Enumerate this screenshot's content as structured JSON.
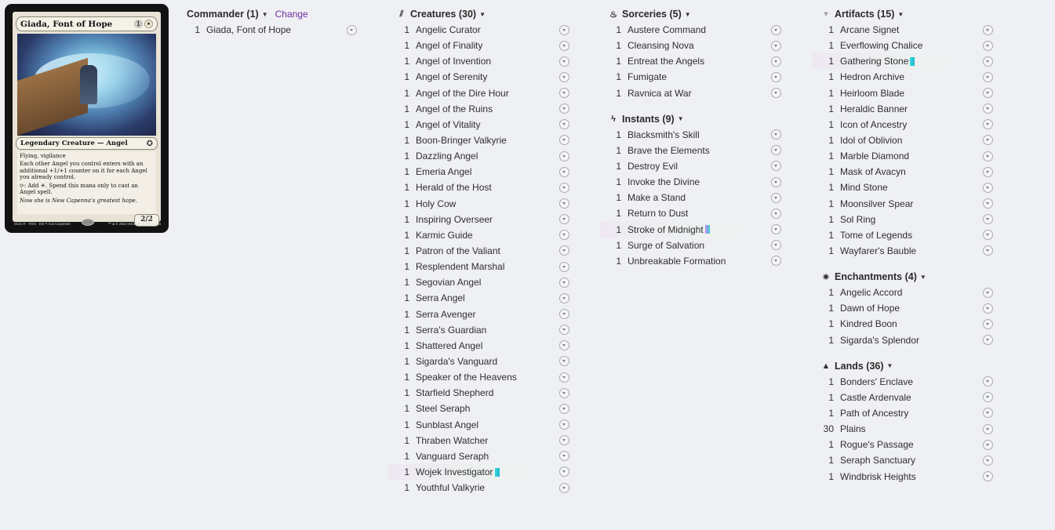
{
  "card": {
    "name": "Giada, Font of Hope",
    "cost_generic": "1",
    "cost_white": "☀",
    "type_line": "Legendary Creature — Angel",
    "rules": [
      "Flying, vigilance",
      "Each other Angel you control enters with an additional +1/+1 counter on it for each Angel you already control.",
      "⟳: Add ☀. Spend this mana only to cast an Angel spell."
    ],
    "flavor": "Now she is New Capenna's greatest hope.",
    "pt": "2/2",
    "footer_left": "0141 R · FDN · EN  ✎ Kai Carpenter",
    "footer_right": "™ & © 2024 Wizards of the Coast"
  },
  "commander": {
    "title": "Commander (1)",
    "change_label": "Change",
    "cards": [
      {
        "qty": "1",
        "name": "Giada, Font of Hope"
      }
    ]
  },
  "creatures": {
    "title": "Creatures (30)",
    "cards": [
      {
        "qty": "1",
        "name": "Angelic Curator"
      },
      {
        "qty": "1",
        "name": "Angel of Finality"
      },
      {
        "qty": "1",
        "name": "Angel of Invention"
      },
      {
        "qty": "1",
        "name": "Angel of Serenity"
      },
      {
        "qty": "1",
        "name": "Angel of the Dire Hour"
      },
      {
        "qty": "1",
        "name": "Angel of the Ruins"
      },
      {
        "qty": "1",
        "name": "Angel of Vitality"
      },
      {
        "qty": "1",
        "name": "Boon-Bringer Valkyrie"
      },
      {
        "qty": "1",
        "name": "Dazzling Angel"
      },
      {
        "qty": "1",
        "name": "Emeria Angel"
      },
      {
        "qty": "1",
        "name": "Herald of the Host"
      },
      {
        "qty": "1",
        "name": "Holy Cow"
      },
      {
        "qty": "1",
        "name": "Inspiring Overseer"
      },
      {
        "qty": "1",
        "name": "Karmic Guide"
      },
      {
        "qty": "1",
        "name": "Patron of the Valiant"
      },
      {
        "qty": "1",
        "name": "Resplendent Marshal"
      },
      {
        "qty": "1",
        "name": "Segovian Angel"
      },
      {
        "qty": "1",
        "name": "Serra Angel"
      },
      {
        "qty": "1",
        "name": "Serra Avenger"
      },
      {
        "qty": "1",
        "name": "Serra's Guardian"
      },
      {
        "qty": "1",
        "name": "Shattered Angel"
      },
      {
        "qty": "1",
        "name": "Sigarda's Vanguard"
      },
      {
        "qty": "1",
        "name": "Speaker of the Heavens"
      },
      {
        "qty": "1",
        "name": "Starfield Shepherd"
      },
      {
        "qty": "1",
        "name": "Steel Seraph"
      },
      {
        "qty": "1",
        "name": "Sunblast Angel"
      },
      {
        "qty": "1",
        "name": "Thraben Watcher"
      },
      {
        "qty": "1",
        "name": "Vanguard Seraph"
      },
      {
        "qty": "1",
        "name": "Wojek Investigator",
        "highlight": true,
        "mark": "cyan"
      },
      {
        "qty": "1",
        "name": "Youthful Valkyrie"
      }
    ]
  },
  "sorceries": {
    "title": "Sorceries (5)",
    "cards": [
      {
        "qty": "1",
        "name": "Austere Command"
      },
      {
        "qty": "1",
        "name": "Cleansing Nova"
      },
      {
        "qty": "1",
        "name": "Entreat the Angels"
      },
      {
        "qty": "1",
        "name": "Fumigate"
      },
      {
        "qty": "1",
        "name": "Ravnica at War"
      }
    ]
  },
  "instants": {
    "title": "Instants (9)",
    "cards": [
      {
        "qty": "1",
        "name": "Blacksmith's Skill"
      },
      {
        "qty": "1",
        "name": "Brave the Elements"
      },
      {
        "qty": "1",
        "name": "Destroy Evil"
      },
      {
        "qty": "1",
        "name": "Invoke the Divine"
      },
      {
        "qty": "1",
        "name": "Make a Stand"
      },
      {
        "qty": "1",
        "name": "Return to Dust"
      },
      {
        "qty": "1",
        "name": "Stroke of Midnight",
        "highlight": true,
        "mark": "purple"
      },
      {
        "qty": "1",
        "name": "Surge of Salvation"
      },
      {
        "qty": "1",
        "name": "Unbreakable Formation"
      }
    ]
  },
  "artifacts": {
    "title": "Artifacts (15)",
    "cards": [
      {
        "qty": "1",
        "name": "Arcane Signet"
      },
      {
        "qty": "1",
        "name": "Everflowing Chalice"
      },
      {
        "qty": "1",
        "name": "Gathering Stone",
        "highlight": true,
        "mark": "cyan"
      },
      {
        "qty": "1",
        "name": "Hedron Archive"
      },
      {
        "qty": "1",
        "name": "Heirloom Blade"
      },
      {
        "qty": "1",
        "name": "Heraldic Banner"
      },
      {
        "qty": "1",
        "name": "Icon of Ancestry"
      },
      {
        "qty": "1",
        "name": "Idol of Oblivion"
      },
      {
        "qty": "1",
        "name": "Marble Diamond"
      },
      {
        "qty": "1",
        "name": "Mask of Avacyn"
      },
      {
        "qty": "1",
        "name": "Mind Stone"
      },
      {
        "qty": "1",
        "name": "Moonsilver Spear"
      },
      {
        "qty": "1",
        "name": "Sol Ring"
      },
      {
        "qty": "1",
        "name": "Tome of Legends"
      },
      {
        "qty": "1",
        "name": "Wayfarer's Bauble"
      }
    ]
  },
  "enchantments": {
    "title": "Enchantments (4)",
    "cards": [
      {
        "qty": "1",
        "name": "Angelic Accord"
      },
      {
        "qty": "1",
        "name": "Dawn of Hope"
      },
      {
        "qty": "1",
        "name": "Kindred Boon"
      },
      {
        "qty": "1",
        "name": "Sigarda's Splendor"
      }
    ]
  },
  "lands": {
    "title": "Lands (36)",
    "cards": [
      {
        "qty": "1",
        "name": "Bonders' Enclave"
      },
      {
        "qty": "1",
        "name": "Castle Ardenvale"
      },
      {
        "qty": "1",
        "name": "Path of Ancestry"
      },
      {
        "qty": "30",
        "name": "Plains"
      },
      {
        "qty": "1",
        "name": "Rogue's Passage"
      },
      {
        "qty": "1",
        "name": "Seraph Sanctuary"
      },
      {
        "qty": "1",
        "name": "Windbrisk Heights"
      }
    ]
  },
  "icons": {
    "creatures": "claw-icon",
    "sorceries": "sorcery-icon",
    "instants": "lightning-icon",
    "artifacts": "chalice-icon",
    "enchantments": "enchantment-icon",
    "lands": "mountain-icon",
    "caret": "caret-down-icon",
    "row_menu": "chevron-circle-icon"
  }
}
